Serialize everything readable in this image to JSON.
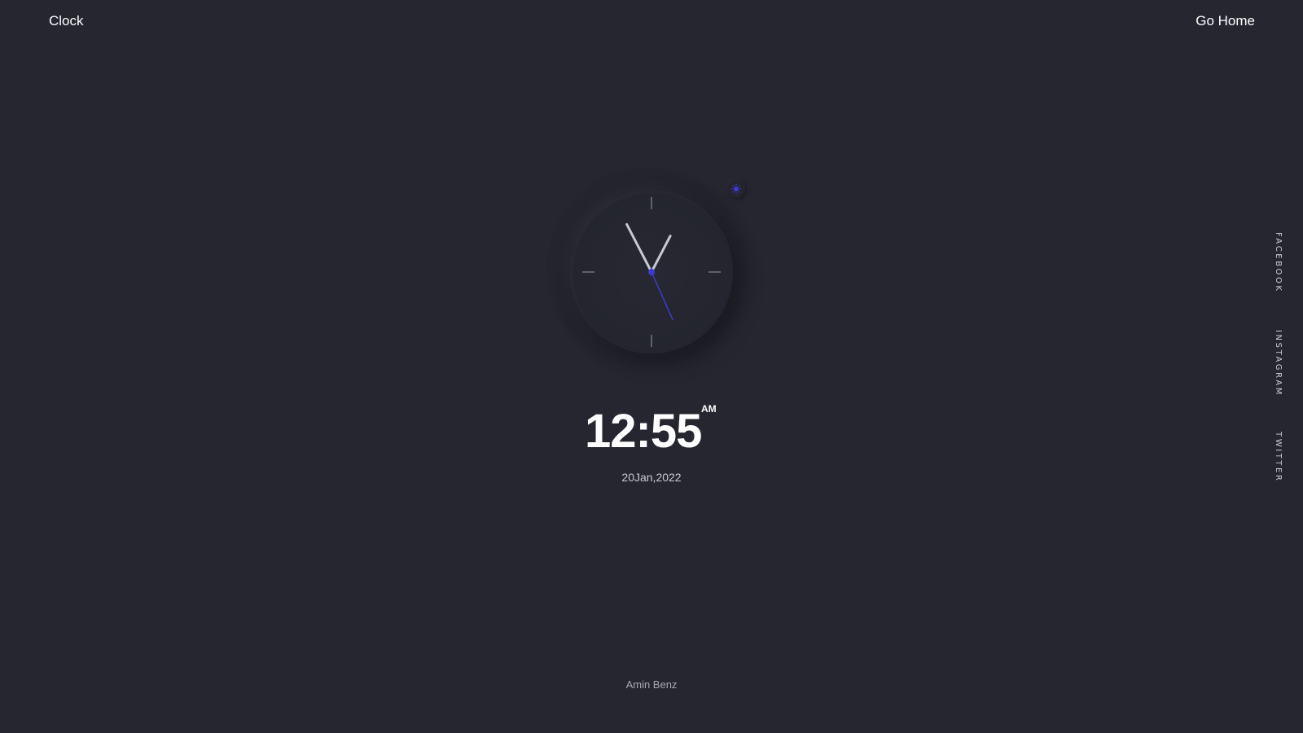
{
  "header": {
    "brand": "Clock",
    "go_home": "Go Home"
  },
  "social": {
    "facebook": "FACEBOOK",
    "instagram": "INSTAGRAM",
    "twitter": "TWITTER"
  },
  "theme_toggle": {
    "icon": "sun-icon",
    "color": "#3b3bd1"
  },
  "clock": {
    "hour": 12,
    "minute": 55,
    "second": 26,
    "accent_color": "#3b3bd1",
    "hand_color": "#c9c8d2"
  },
  "digital": {
    "time": "12:55",
    "ampm": "AM",
    "date": "20Jan,2022"
  },
  "footer": {
    "author": "Amin Benz"
  },
  "colors": {
    "background": "#25262f",
    "text": "#ffffff"
  }
}
